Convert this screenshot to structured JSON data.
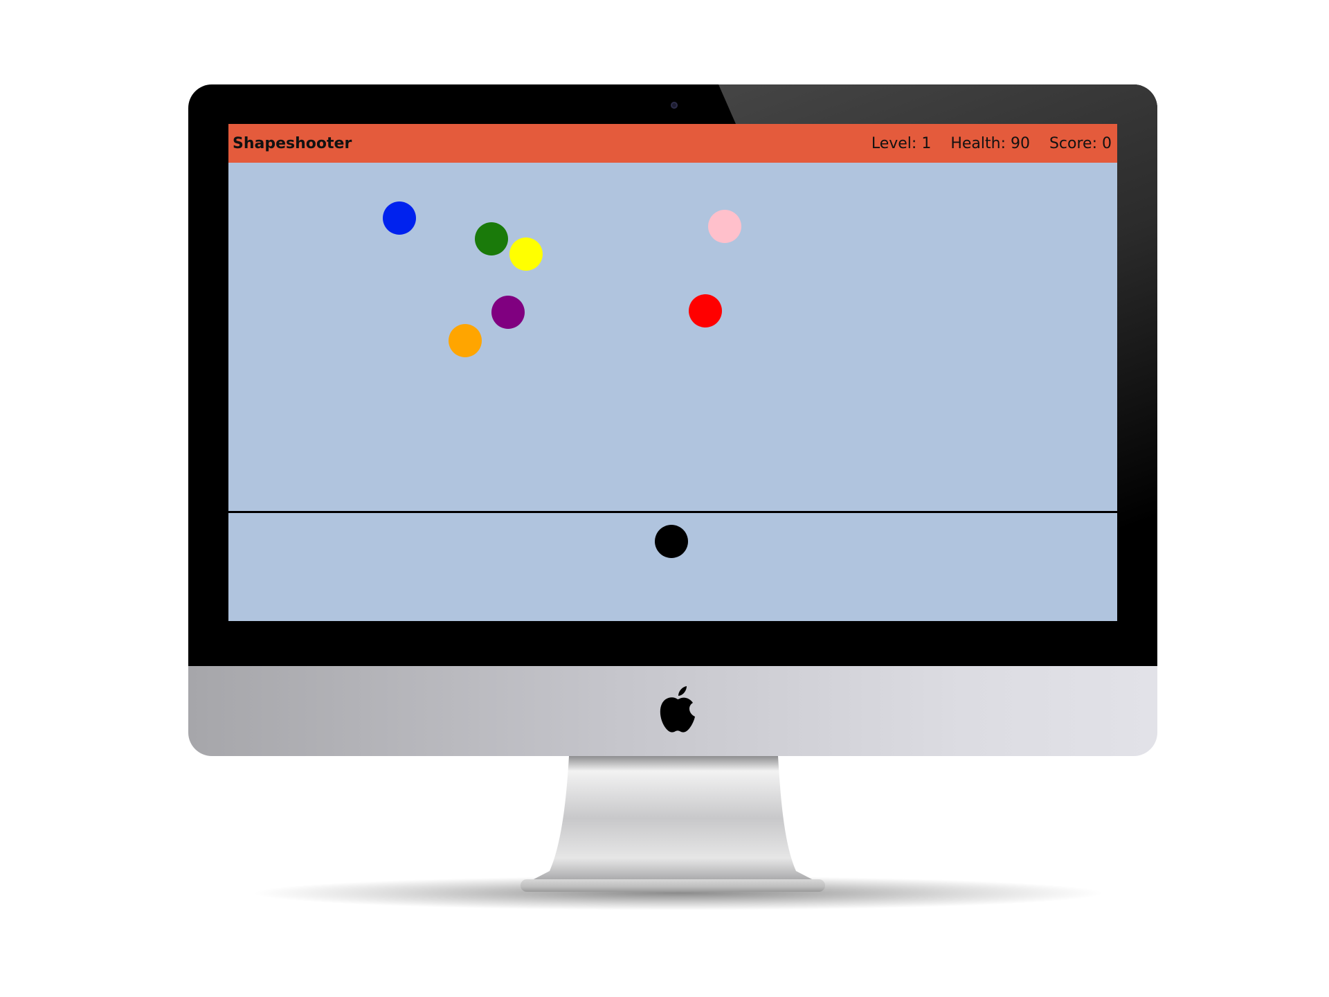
{
  "game": {
    "title": "Shapeshooter",
    "stats": {
      "level": "Level: 1",
      "health": "Health: 90",
      "score": "Score: 0"
    }
  },
  "colors": {
    "topbar": "#e45b3c",
    "playfield": "#b0c4de",
    "player": "#000000"
  },
  "targets": [
    {
      "name": "blue-shape",
      "color": "#0022ee"
    },
    {
      "name": "green-shape",
      "color": "#1a7a0a"
    },
    {
      "name": "yellow-shape",
      "color": "#ffff00"
    },
    {
      "name": "pink-shape",
      "color": "#ffc0cb"
    },
    {
      "name": "purple-shape",
      "color": "#800080"
    },
    {
      "name": "red-shape",
      "color": "#ff0000"
    },
    {
      "name": "orange-shape",
      "color": "#ffa500"
    }
  ],
  "icons": {
    "webcam": "webcam-icon",
    "logo": "apple-logo-icon"
  }
}
